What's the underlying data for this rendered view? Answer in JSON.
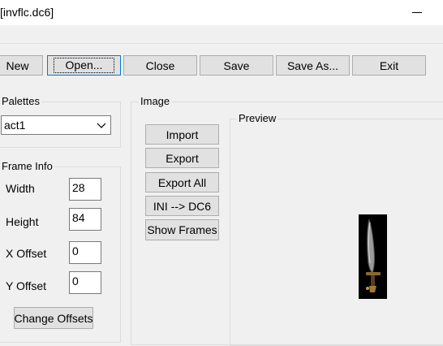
{
  "window": {
    "title": "[invflc.dc6]"
  },
  "toolbar": {
    "new_label": "New",
    "open_label": "Open...",
    "close_label": "Close",
    "save_label": "Save",
    "save_as_label": "Save As...",
    "exit_label": "Exit"
  },
  "palettes": {
    "label": "Palettes",
    "selected": "act1"
  },
  "frame_info": {
    "label": "Frame Info",
    "width_label": "Width",
    "width_value": "28",
    "height_label": "Height",
    "height_value": "84",
    "x_offset_label": "X Offset",
    "x_offset_value": "0",
    "y_offset_label": "Y Offset",
    "y_offset_value": "0",
    "change_offsets_label": "Change Offsets"
  },
  "image": {
    "label": "Image",
    "import_label": "Import",
    "export_label": "Export",
    "export_all_label": "Export All",
    "ini_dc6_label": "INI --> DC6",
    "show_frames_label": "Show Frames"
  },
  "preview": {
    "label": "Preview",
    "sprite_icon": "sword-icon"
  },
  "colors": {
    "accent": "#0078d7",
    "button_face": "#e1e1e1",
    "window_bg": "#f0f0f0"
  }
}
